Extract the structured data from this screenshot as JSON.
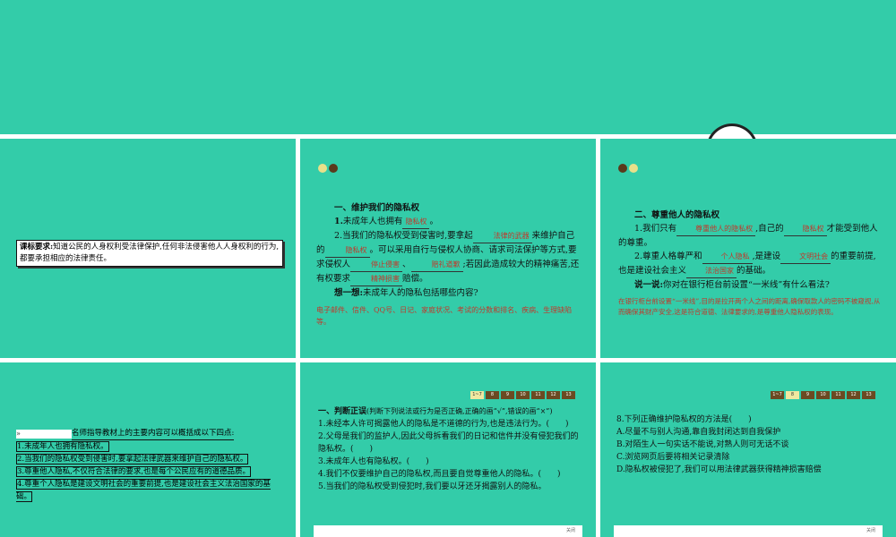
{
  "colors": {
    "background": "#33cca9",
    "answer": "#c0392b"
  },
  "slide1": {
    "req_label": "课标要求:",
    "req_text": "知道公民的人身权利受法律保护,任何非法侵害他人人身权利的行为,都要承担相应的法律责任。"
  },
  "slide2": {
    "heading": "一、维护我们的隐私权",
    "q1_a": "1.",
    "q1_b": "未成年人也拥有",
    "q1_ans": "隐私权",
    "q1_end": "。",
    "q2_a": "2.当我们的隐私权受到侵害时,要拿起",
    "q2_ans1": "法律的武器",
    "q2_b": "来维护自己的",
    "q2_ans2": "隐私权",
    "q2_c": "。可以采用自行与侵权人协商、请求司法保护等方式,要求侵权人",
    "q2_ans3": "停止侵害",
    "q2_d": "、",
    "q2_ans4": "赔礼道歉",
    "q2_e": ";若因此造成较大的精神痛苦,还有权要求",
    "q2_ans5": "精神损害",
    "q2_f": "赔偿。",
    "think_label": "想一想:",
    "think_text": "未成年人的隐私包括哪些内容?",
    "think_ans": "电子邮件、信件、QQ号、日记、家庭状况、考试的分数和排名、疾病、生理缺陷等。"
  },
  "slide3": {
    "heading": "二、尊重他人的隐私权",
    "q1_a": "1.我们只有",
    "q1_ans1": "尊重他人的隐私权",
    "q1_b": ",自己的",
    "q1_ans2": "隐私权",
    "q1_c": "才能受到他人的尊重。",
    "q2_a": "2.尊重人格尊严和",
    "q2_ans1": "个人隐私",
    "q2_b": ",是建设",
    "q2_ans2": "文明社会",
    "q2_c": "的重要前提,也是建设社会主义",
    "q2_ans3": "法治国家",
    "q2_d": "的基础。",
    "say_label": "说一说:",
    "say_text": "你对在银行柜台前设置“一米线”有什么看法?",
    "say_ans": "在银行柜台前设置“一米线”,目的是拉开两个人之间的距离,确保取款人的密码不被窥视,从而确保其财产安全,这是符合道德、法律要求的,是尊重他人隐私权的表现。"
  },
  "slide4": {
    "title": "名师指导教材上的主要内容可以概括成以下四点:",
    "points": [
      "1.未成年人也拥有隐私权。",
      "2.当我们的隐私权受到侵害时,要拿起法律武器来维护自己的隐私权。",
      "3.尊重他人隐私,不仅符合法律的要求,也是每个公民应有的道德品质。",
      "4.尊重个人隐私是建设文明社会的重要前提,也是建设社会主义法治国家的基础。"
    ]
  },
  "nav": [
    "1~7",
    "8",
    "9",
    "10",
    "11",
    "12",
    "13"
  ],
  "slide5": {
    "heading_bold": "一、判断正误",
    "heading_rest": "(判断下列说法或行为是否正确,正确的画“√”,错误的画“×”)",
    "items": [
      "1.未经本人许可揭露他人的隐私是不道德的行为,也是违法行为。(　　)",
      "2.父母是我们的监护人,因此父母拆看我们的日记和信件并没有侵犯我们的隐私权。(　　)",
      "3.未成年人也有隐私权。(　　)",
      "4.我们不仅要维护自己的隐私权,而且要自觉尊重他人的隐私。(　　)",
      "5.当我们的隐私权受到侵犯时,我们要以牙还牙揭露别人的隐私。"
    ],
    "close": "关闭"
  },
  "slide6": {
    "question": "8.下列正确维护隐私权的方法是(　　)",
    "options": [
      "A.尽量不与别人沟通,靠自我封闭达到自我保护",
      "B.对陌生人一句实话不能说,对熟人则可无话不谈",
      "C.浏览网页后要将相关记录清除",
      "D.隐私权被侵犯了,我们可以用法律武器获得精神损害赔偿"
    ],
    "close": "关闭"
  }
}
